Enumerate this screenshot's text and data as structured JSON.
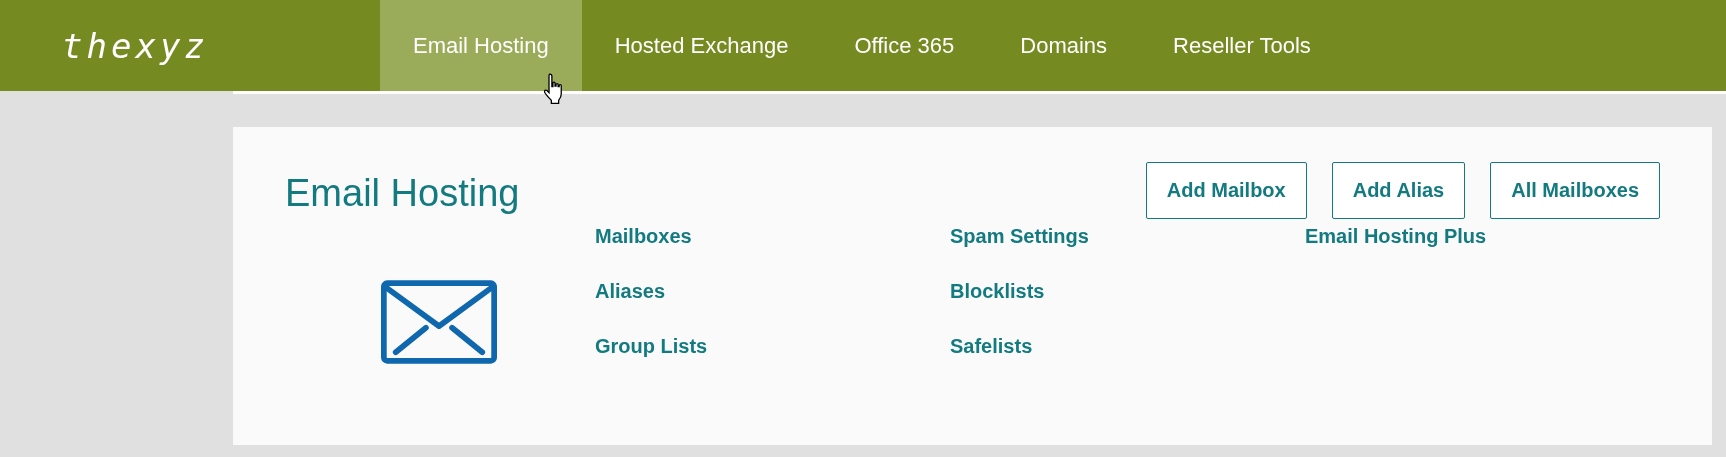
{
  "header": {
    "logo": "thexyz",
    "tabs": [
      {
        "label": "Email Hosting",
        "selected": true
      },
      {
        "label": "Hosted Exchange",
        "selected": false
      },
      {
        "label": "Office 365",
        "selected": false
      },
      {
        "label": "Domains",
        "selected": false
      },
      {
        "label": "Reseller Tools",
        "selected": false
      }
    ]
  },
  "panel": {
    "title": "Email Hosting",
    "buttons": [
      "Add Mailbox",
      "Add Alias",
      "All Mailboxes"
    ],
    "link_columns": [
      [
        "Mailboxes",
        "Aliases",
        "Group Lists"
      ],
      [
        "Spam Settings",
        "Blocklists",
        "Safelists"
      ],
      [
        "Email Hosting Plus"
      ]
    ]
  }
}
